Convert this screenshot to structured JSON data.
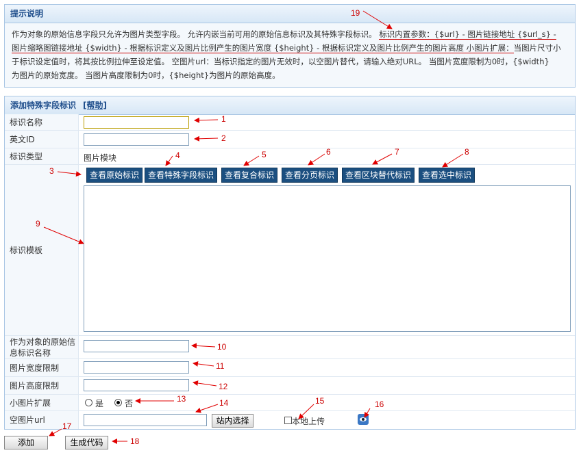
{
  "tips": {
    "title": "提示说明",
    "line1_a": "作为对象的原始信息字段只允许为图片类型字段。 允许内嵌当前可用的原始信息标识及其特殊字段标识。",
    "line1_b": "标识内置参数：{$url} - 图片链接地址 {$url_s} -",
    "line2_a": "图片缩略图链接地址 {$width} - 根据标识定义及图片比例产生的图片宽度 {$height} - 根据标识定义及图片比例产生的图片高度 小图片扩展：",
    "line2_b": "当图片尺寸小",
    "line3": "于标识设定值时，将其按比例拉伸至设定值。 空图片url：当标识指定的图片无效时，以空图片替代，请输入绝对URL。 当图片宽度限制为0时，{$width}",
    "line4": "为图片的原始宽度。 当图片高度限制为0时，{$height}为图片的原始高度。"
  },
  "form": {
    "title": "添加特殊字段标识",
    "help": "[帮助]",
    "name_label": "标识名称",
    "en_label": "英文ID",
    "type_label": "标识类型",
    "type_value": "图片模块",
    "template_label": "标识模板",
    "buttons": [
      "查看原始标识",
      "查看特殊字段标识",
      "查看复合标识",
      "查看分页标识",
      "查看区块替代标识",
      "查看选中标识"
    ],
    "source_label": "作为对象的原始信息标识名称",
    "width_label": "图片宽度限制",
    "height_label": "图片高度限制",
    "small_label": "小图片扩展",
    "yes": "是",
    "no": "否",
    "empty_label": "空图片url",
    "site_select": "站内选择",
    "local_upload": "本地上传",
    "add": "添加",
    "gen_code": "生成代码"
  },
  "annotations": [
    "1",
    "2",
    "3",
    "4",
    "5",
    "6",
    "7",
    "8",
    "9",
    "10",
    "11",
    "12",
    "13",
    "14",
    "15",
    "16",
    "17",
    "18",
    "19"
  ],
  "colors": {
    "arrow": "#e00000",
    "button_bg": "#1b4f80",
    "header_text": "#1f4e8c"
  }
}
